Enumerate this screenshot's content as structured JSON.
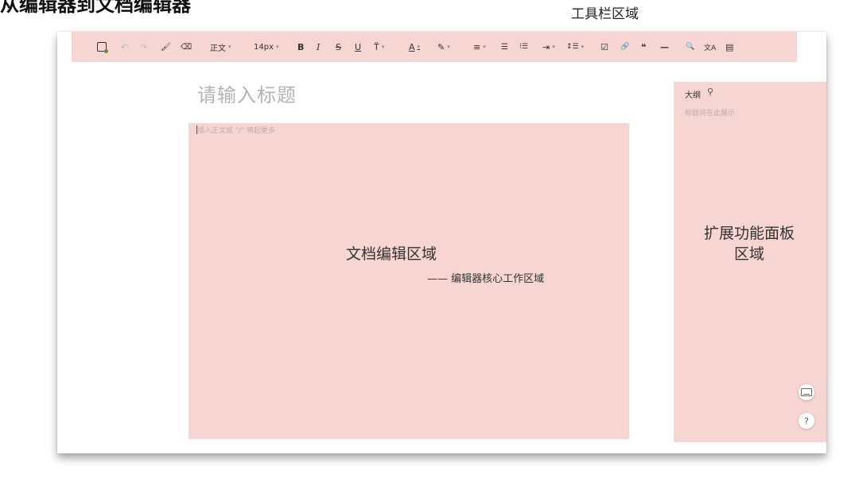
{
  "annotations": {
    "heading": "从编辑器到文档编辑器",
    "toolbar_region": "工具栏区域",
    "editor_region": "文档编辑区域",
    "editor_region_sub": "—— 编辑器核心工作区域",
    "panel_region_line1": "扩展功能面板",
    "panel_region_line2": "区域"
  },
  "toolbar": {
    "undo": "↶",
    "redo": "↷",
    "format_painter": "🖌",
    "clear_format": "⌫",
    "paragraph_style": "正文",
    "font_size": "14px",
    "bold": "B",
    "italic": "I",
    "strikethrough": "S",
    "underline": "U",
    "more_text": "T̈",
    "font_color": "A",
    "highlight": "✎",
    "align": "≡",
    "bullet_list": "☰",
    "ordered_list": "⁝☰",
    "indent": "⇥",
    "line_height": "↕☰",
    "task_list": "☑",
    "link": "🔗",
    "quote": "❝",
    "divider": "—",
    "search": "🔍",
    "translate": "文A",
    "template": "▤",
    "caret": "▾"
  },
  "document": {
    "title_placeholder": "请输入标题",
    "body_placeholder": "插入正文或 \"/\" 唤起更多"
  },
  "outline": {
    "title": "大纲",
    "pin": "⚲",
    "empty_text": "标题将在此展示"
  },
  "floating": {
    "help": "?"
  },
  "colors": {
    "region_highlight": "#f6d5d2",
    "title_placeholder": "#b3b3b3"
  }
}
